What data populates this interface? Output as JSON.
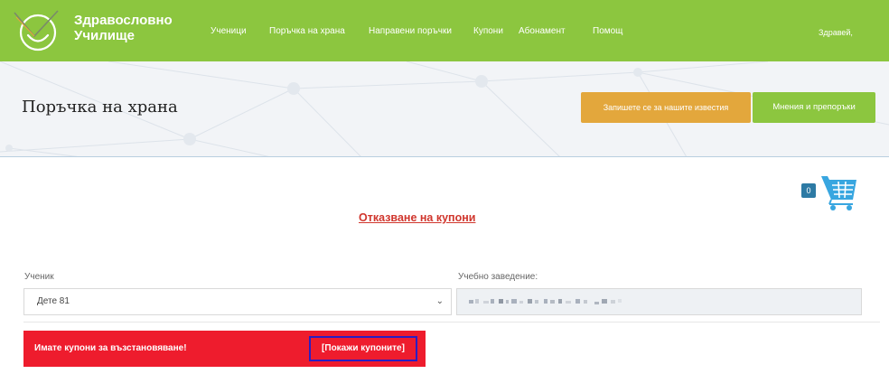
{
  "header": {
    "brand_line1": "Здравословно",
    "brand_line2": "Училище",
    "nav": [
      "Ученици",
      "Поръчка на храна",
      "Направени поръчки",
      "Купони",
      "Абонамент",
      "Помощ"
    ],
    "greeting": "Здравей,",
    "logo_icon": "smile-check-logo-icon"
  },
  "banner": {
    "title": "Поръчка на храна",
    "subscribe_label": "Запишете се за нашите известия",
    "reviews_label": "Мнения и препоръки"
  },
  "cart": {
    "count": "0",
    "icon": "cart-icon"
  },
  "cancel_coupons_label": "Отказване на купони",
  "form": {
    "student_label": "Ученик",
    "student_value": "Дете 81",
    "school_label": "Учебно заведение:"
  },
  "alert": {
    "message": "Имате купони за възстановяване!",
    "show_label": "[Покажи купоните]"
  },
  "colors": {
    "brand_green": "#8cc63f",
    "orange": "#e3a73c",
    "alert_red": "#ee1c2d",
    "link_red": "#d0362d",
    "cart_blue": "#2d7aa4"
  }
}
